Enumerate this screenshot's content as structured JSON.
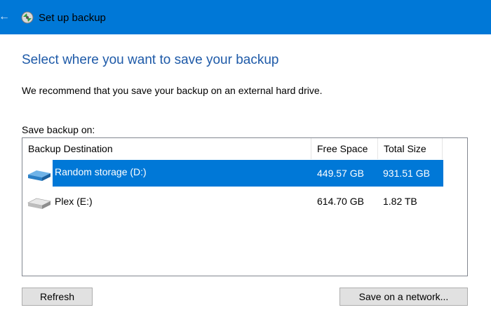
{
  "window": {
    "title": "Set up backup"
  },
  "page": {
    "heading": "Select where you want to save your backup",
    "recommendation": "We recommend that you save your backup on an external hard drive.",
    "save_on_label": "Save backup on:"
  },
  "table": {
    "columns": [
      "Backup Destination",
      "Free Space",
      "Total Size"
    ],
    "rows": [
      {
        "name": "Random storage (D:)",
        "free": "449.57 GB",
        "total": "931.51 GB",
        "selected": true,
        "icon": "drive-blue-icon"
      },
      {
        "name": "Plex (E:)",
        "free": "614.70 GB",
        "total": "1.82 TB",
        "selected": false,
        "icon": "drive-gray-icon"
      }
    ]
  },
  "buttons": {
    "refresh": "Refresh",
    "save_network": "Save on a network..."
  },
  "colors": {
    "titlebar": "#0078d7",
    "heading": "#1e5aa8",
    "selection": "#0078d7"
  }
}
